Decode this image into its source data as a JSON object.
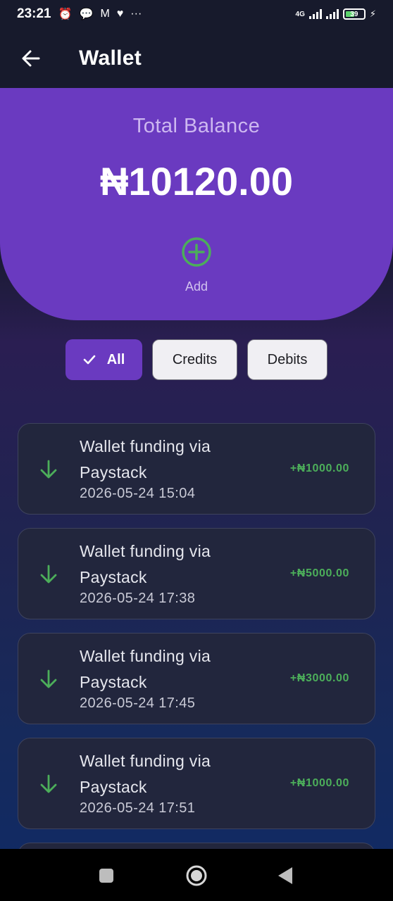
{
  "status_bar": {
    "time": "23:21",
    "network": "4G",
    "battery": "39"
  },
  "header": {
    "title": "Wallet",
    "back_icon": "arrow-left-icon"
  },
  "balance": {
    "label": "Total Balance",
    "amount": "₦10120.00",
    "add_label": "Add",
    "accent": "#6a3ac0",
    "add_color": "#4cae5a"
  },
  "filters": {
    "selected": "All",
    "items": [
      {
        "label": "All"
      },
      {
        "label": "Credits"
      },
      {
        "label": "Debits"
      }
    ]
  },
  "transactions": [
    {
      "line1": "Wallet funding via",
      "line2": "Paystack",
      "date": "2026-05-24 15:04",
      "amount": "+₦1000.00",
      "icon": "arrow-down-icon"
    },
    {
      "line1": "Wallet funding via",
      "line2": "Paystack",
      "date": "2026-05-24 17:38",
      "amount": "+₦5000.00",
      "icon": "arrow-down-icon"
    },
    {
      "line1": "Wallet funding via",
      "line2": "Paystack",
      "date": "2026-05-24 17:45",
      "amount": "+₦3000.00",
      "icon": "arrow-down-icon"
    },
    {
      "line1": "Wallet funding via",
      "line2": "Paystack",
      "date": "2026-05-24 17:51",
      "amount": "+₦1000.00",
      "icon": "arrow-down-icon"
    }
  ],
  "colors": {
    "credit_green": "#4cae5a",
    "card_bg": "#22263d"
  }
}
